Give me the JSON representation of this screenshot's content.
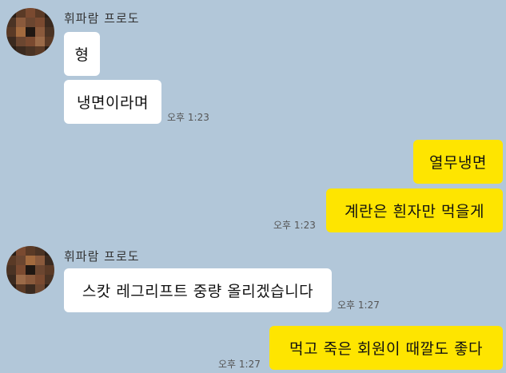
{
  "colors": {
    "background": "#b2c7d9",
    "incoming_bubble": "#ffffff",
    "outgoing_bubble": "#fee500"
  },
  "messages": [
    {
      "sender": "휘파람 프로도",
      "text": "형",
      "side": "in"
    },
    {
      "text": "냉면이라며",
      "side": "in",
      "time": "오후 1:23"
    },
    {
      "text": "열무냉면",
      "side": "out"
    },
    {
      "text": "계란은 흰자만 먹을게",
      "side": "out",
      "time": "오후 1:23"
    },
    {
      "sender": "휘파람 프로도",
      "text": "스캇 레그리프트 중량 올리겠습니다",
      "side": "in",
      "time": "오후 1:27"
    },
    {
      "text": "먹고 죽은 회원이 때깔도 좋다",
      "side": "out",
      "time": "오후 1:27"
    }
  ]
}
